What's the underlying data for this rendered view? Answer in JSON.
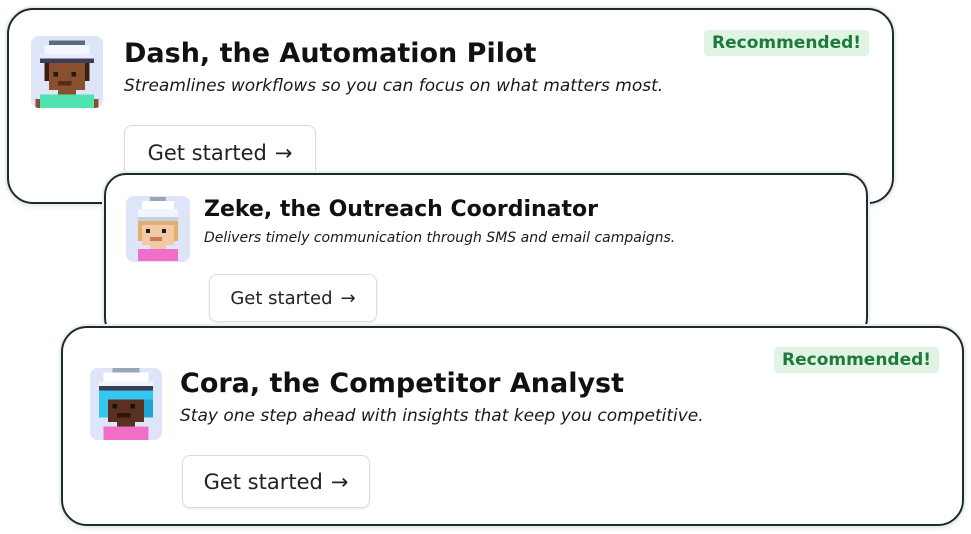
{
  "cards": [
    {
      "title": "Dash, the Automation Pilot",
      "subtitle": "Streamlines workflows so you can focus on what matters most.",
      "button_label": "Get started",
      "button_arrow": "→",
      "badge": "Recommended!",
      "avatar": "pixel-avatar-dash"
    },
    {
      "title": "Zeke, the Outreach Coordinator",
      "subtitle": "Delivers timely communication through SMS and email campaigns.",
      "button_label": "Get started",
      "button_arrow": "→",
      "avatar": "pixel-avatar-zeke"
    },
    {
      "title": "Cora, the Competitor Analyst",
      "subtitle": "Stay one step ahead with insights that keep you competitive.",
      "button_label": "Get started",
      "button_arrow": "→",
      "badge": "Recommended!",
      "avatar": "pixel-avatar-cora"
    }
  ],
  "colors": {
    "card_border": "#1f2a30",
    "badge_bg": "#e1f4e4",
    "badge_text": "#1e7a3c",
    "avatar_bg": "#dfe5f9"
  }
}
